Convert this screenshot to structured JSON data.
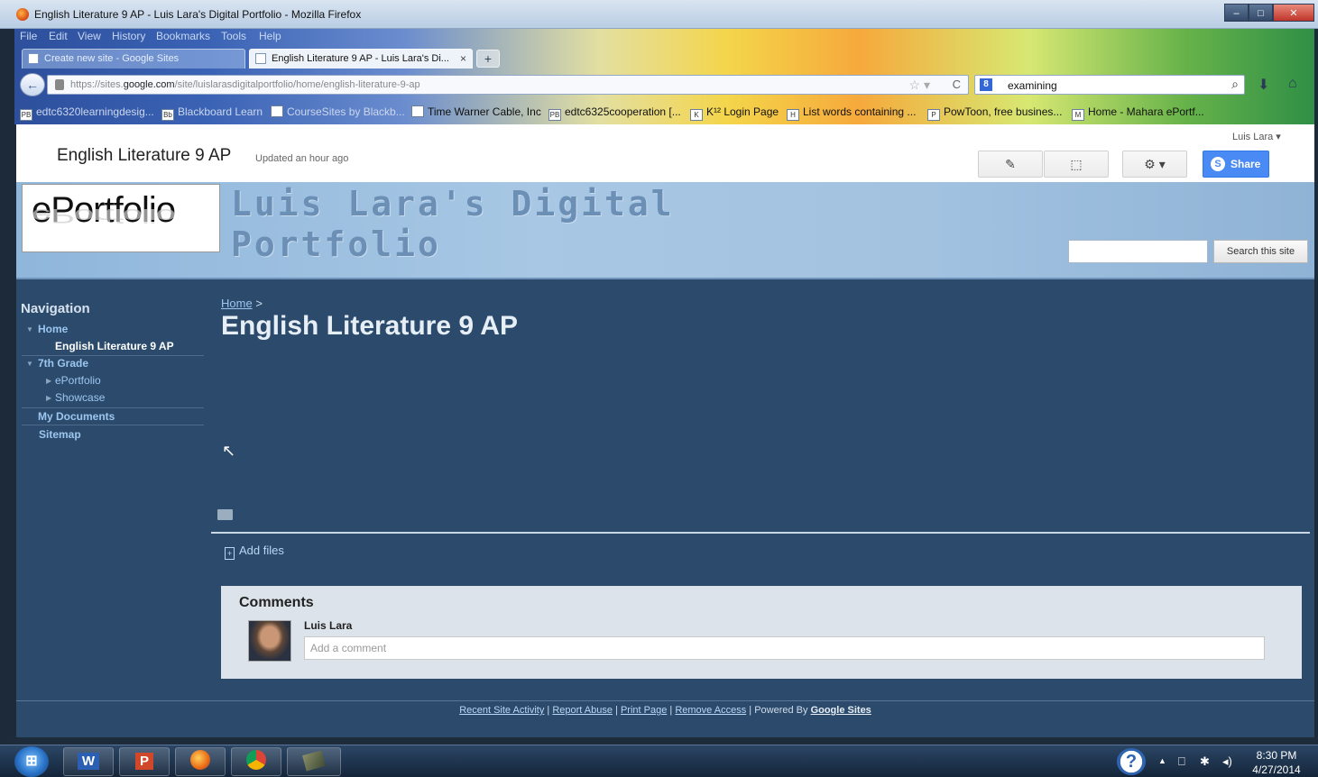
{
  "window": {
    "title": "English Literature 9 AP - Luis Lara's Digital Portfolio - Mozilla Firefox",
    "min": "–",
    "max": "□",
    "close": "✕"
  },
  "menu": [
    "File",
    "Edit",
    "View",
    "History",
    "Bookmarks",
    "Tools",
    "Help"
  ],
  "tabs": [
    {
      "label": "Create new site - Google Sites",
      "active": false
    },
    {
      "label": "English Literature 9 AP - Luis Lara's Di...",
      "active": true
    }
  ],
  "tab_close": "×",
  "new_tab": "+",
  "navbar": {
    "back": "←",
    "url_prefix": "https://sites.",
    "url_domain": "google.com",
    "url_path": "/site/luislarasdigitalportfolio/home/english-literature-9-ap",
    "star": "☆ ▾",
    "reload": "C",
    "search_engine": "8",
    "search_value": "examining",
    "search_glyph": "⌕",
    "download_glyph": "⬇",
    "home_glyph": "⌂"
  },
  "bookmarks": [
    {
      "icon": "PB",
      "label": "edtc6320learningdesig...",
      "faded": true
    },
    {
      "icon": "Bb",
      "label": "Blackboard Learn",
      "faded": true
    },
    {
      "icon": "",
      "label": "CourseSites by Blackb...",
      "faded": true
    },
    {
      "icon": "",
      "label": "Time Warner Cable, Inc",
      "faded": false
    },
    {
      "icon": "PB",
      "label": "edtc6325cooperation [...",
      "faded": false
    },
    {
      "icon": "K",
      "label": "K¹² Login Page",
      "faded": false
    },
    {
      "icon": "H",
      "label": "List words containing ...",
      "faded": false
    },
    {
      "icon": "P",
      "label": "PowToon, free busines...",
      "faded": false
    },
    {
      "icon": "M",
      "label": "Home - Mahara ePortf...",
      "faded": false
    }
  ],
  "site": {
    "name": "English Literature 9 AP",
    "updated": "Updated an hour ago",
    "user": "Luis Lara ▾",
    "edit_glyph": "✎",
    "newpage_glyph": "⬚",
    "settings_glyph": "⚙ ▾",
    "share_label": "Share",
    "share_glyph": "S",
    "logo": "ePortfolio",
    "banner_title": "Luis Lara's Digital Portfolio",
    "search_button": "Search this site"
  },
  "nav": {
    "heading": "Navigation",
    "items": [
      {
        "label": "Home",
        "expanded": true
      },
      {
        "label": "English Literature 9 AP",
        "current": true
      },
      {
        "label": "7th Grade",
        "expanded": true
      },
      {
        "label": "ePortfolio"
      },
      {
        "label": "Showcase"
      },
      {
        "label": "My Documents"
      },
      {
        "label": "Sitemap"
      }
    ],
    "arrow_down": "▼",
    "arrow_right": "▶"
  },
  "main": {
    "breadcrumb_home": "Home",
    "breadcrumb_sep": ">",
    "title": "English Literature 9 AP",
    "add_files": "Add files",
    "add_files_glyph": "+",
    "cursor": "↖"
  },
  "comments": {
    "title": "Comments",
    "author": "Luis Lara",
    "placeholder": "Add a comment"
  },
  "footer": {
    "links": [
      "Recent Site Activity",
      "Report Abuse",
      "Print Page",
      "Remove Access"
    ],
    "sep": "|",
    "powered": "Powered By",
    "google_sites": "Google Sites"
  },
  "taskbar": {
    "start": "⊞",
    "word": "W",
    "ppt": "P",
    "help": "?",
    "tray_up": "▲",
    "tray_net": "⎕",
    "tray_shield": "✱",
    "tray_vol": "◂)",
    "time": "8:30 PM",
    "date": "4/27/2014"
  }
}
